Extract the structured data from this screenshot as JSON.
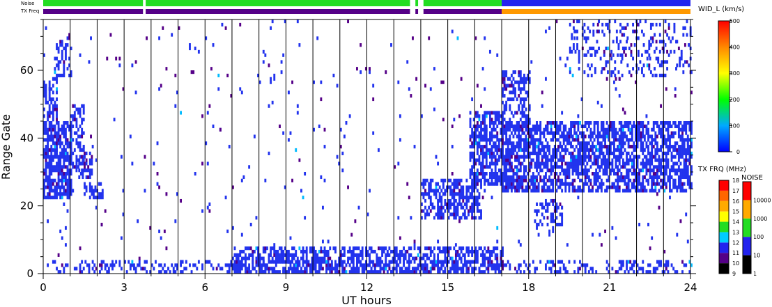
{
  "chart_data": {
    "type": "heatmap",
    "xlabel": "UT hours",
    "ylabel": "Range Gate",
    "xlim": [
      0,
      24
    ],
    "ylim": [
      0,
      75
    ],
    "x_ticks": [
      0,
      3,
      6,
      9,
      12,
      15,
      18,
      21,
      24
    ],
    "y_ticks": [
      0,
      20,
      40,
      60
    ],
    "hour_lines": [
      1,
      2,
      3,
      4,
      5,
      6,
      7,
      8,
      9,
      10,
      11,
      12,
      13,
      14,
      15,
      16,
      17,
      18,
      19,
      20,
      21,
      22,
      23
    ],
    "strip_labels": {
      "noise": "Noise",
      "txfreq": "TX Freq"
    },
    "noise_strip": [
      {
        "from": 0,
        "to": 3.7,
        "color": "#22dd22"
      },
      {
        "from": 3.8,
        "to": 13.6,
        "color": "#22dd22"
      },
      {
        "from": 13.8,
        "to": 13.9,
        "color": "#22dd22"
      },
      {
        "from": 14.1,
        "to": 17.0,
        "color": "#22dd22"
      },
      {
        "from": 17.0,
        "to": 24.0,
        "color": "#2222ee"
      }
    ],
    "txfreq_strip": [
      {
        "from": 0,
        "to": 3.7,
        "color": "#550088"
      },
      {
        "from": 3.8,
        "to": 13.6,
        "color": "#550088"
      },
      {
        "from": 13.8,
        "to": 13.9,
        "color": "#550088"
      },
      {
        "from": 14.1,
        "to": 17.0,
        "color": "#550088"
      },
      {
        "from": 17.0,
        "to": 24.0,
        "color": "#ff9900"
      }
    ],
    "regions": [
      {
        "x": [
          0.0,
          1.0
        ],
        "y": [
          22,
          45
        ],
        "density": 0.75,
        "color": "#2233ee"
      },
      {
        "x": [
          0.0,
          0.5
        ],
        "y": [
          45,
          58
        ],
        "density": 0.5,
        "color": "#2233ee"
      },
      {
        "x": [
          0.4,
          1.0
        ],
        "y": [
          58,
          70
        ],
        "density": 0.35,
        "color": "#2233ee"
      },
      {
        "x": [
          1.0,
          1.5
        ],
        "y": [
          30,
          50
        ],
        "density": 0.45,
        "color": "#2233ee"
      },
      {
        "x": [
          1.3,
          1.8
        ],
        "y": [
          28,
          36
        ],
        "density": 0.45,
        "color": "#2233ee"
      },
      {
        "x": [
          1.5,
          2.2
        ],
        "y": [
          22,
          27
        ],
        "density": 0.55,
        "color": "#2233ee"
      },
      {
        "x": [
          0.0,
          24.0
        ],
        "y": [
          0,
          4
        ],
        "density": 0.3,
        "color": "#2233ee"
      },
      {
        "x": [
          7.0,
          17.0
        ],
        "y": [
          0,
          8
        ],
        "density": 0.55,
        "color": "#2233ee"
      },
      {
        "x": [
          14.0,
          16.2
        ],
        "y": [
          16,
          28
        ],
        "density": 0.55,
        "color": "#2233ee"
      },
      {
        "x": [
          15.8,
          17.0
        ],
        "y": [
          26,
          48
        ],
        "density": 0.65,
        "color": "#2233ee"
      },
      {
        "x": [
          17.0,
          24.0
        ],
        "y": [
          24,
          45
        ],
        "density": 0.65,
        "color": "#2233ee"
      },
      {
        "x": [
          17.0,
          18.0
        ],
        "y": [
          42,
          60
        ],
        "density": 0.5,
        "color": "#2233ee"
      },
      {
        "x": [
          19.5,
          24.0
        ],
        "y": [
          58,
          75
        ],
        "density": 0.2,
        "color": "#2233ee"
      },
      {
        "x": [
          18.2,
          19.2
        ],
        "y": [
          14,
          22
        ],
        "density": 0.35,
        "color": "#2233ee"
      },
      {
        "x": [
          0.0,
          24.0
        ],
        "y": [
          8,
          75
        ],
        "density": 0.012,
        "color": "#2233ee"
      },
      {
        "x": [
          0.0,
          24.0
        ],
        "y": [
          0,
          75
        ],
        "density": 0.004,
        "color": "#550088"
      }
    ],
    "colorbar_width": {
      "title": "WID_L (km/s)",
      "range": [
        0,
        500
      ],
      "ticks": [
        0,
        100,
        200,
        300,
        400,
        500
      ],
      "stops": [
        "#0000ff",
        "#00aaff",
        "#00ff00",
        "#ffff00",
        "#ff8800",
        "#ff0000"
      ]
    },
    "colorbar_txfreq": {
      "title": "TX FRQ (MHz)",
      "ticks": [
        9,
        10,
        11,
        12,
        13,
        14,
        15,
        16,
        17,
        18
      ],
      "colors": [
        "#000000",
        "#550088",
        "#2222ee",
        "#00ccff",
        "#22dd22",
        "#ffff00",
        "#ffaa00",
        "#ff6600",
        "#ff0000"
      ]
    },
    "colorbar_noise": {
      "title": "NOISE",
      "ticks": [
        "1",
        "10",
        "100",
        "1000",
        "10000"
      ],
      "colors": [
        "#000000",
        "#2222ee",
        "#22dd22",
        "#ffaa00",
        "#ff0000"
      ]
    }
  }
}
